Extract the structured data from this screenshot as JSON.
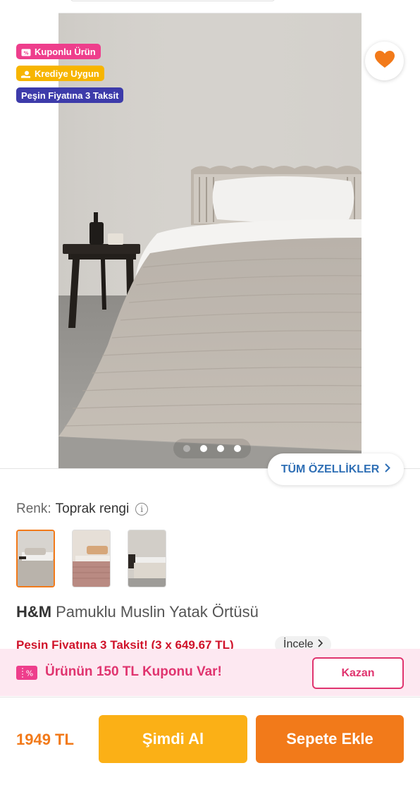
{
  "badges": {
    "coupon": "Kuponlu Ürün",
    "credit": "Krediye Uygun",
    "installment": "Peşin Fiyatına 3 Taksit"
  },
  "gallery": {
    "total_images": 4,
    "active_index": 1
  },
  "all_specs_label": "TÜM ÖZELLİKLER",
  "color": {
    "label": "Renk:",
    "value": "Toprak rengi"
  },
  "product": {
    "brand": "H&M",
    "name": "Pamuklu Muslin Yatak Örtüsü"
  },
  "installment_line": {
    "text": "Peşin Fiyatına 3 Taksit! (3 x 649,67 TL)",
    "link": "İncele"
  },
  "coupon_bar": {
    "text": "Ürünün 150 TL Kuponu Var!",
    "button": "Kazan"
  },
  "footer": {
    "price": "1949 TL",
    "buy_now": "Şimdi Al",
    "add_to_cart": "Sepete Ekle"
  },
  "colors": {
    "accent_orange": "#f27a1a",
    "buy_yellow": "#fbb016",
    "coupon_pink": "#ee3e8c",
    "link_blue": "#2f6fb5",
    "installment_red": "#d0122a"
  },
  "icons": {
    "favorite": "heart-icon",
    "info": "info-icon",
    "chevron": "chevron-right-icon",
    "coupon": "ticket-icon"
  }
}
